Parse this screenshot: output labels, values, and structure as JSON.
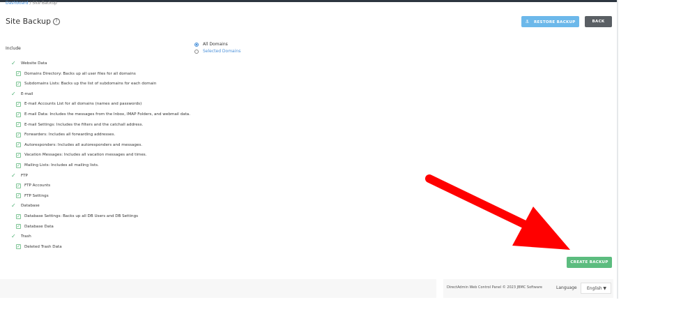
{
  "breadcrumb": {
    "parent": "Dashboard",
    "separator": " / ",
    "current": "Site Backup"
  },
  "page_title": "Site Backup",
  "help_icon": "question-circle-icon",
  "buttons": {
    "restore": "RESTORE BACKUP",
    "back": "BACK",
    "create": "CREATE BACKUP"
  },
  "include": {
    "label": "Include",
    "options": [
      "All Domains",
      "Selected Domains"
    ],
    "selected": "All Domains"
  },
  "tree": [
    {
      "type": "group",
      "label": "Website Data"
    },
    {
      "type": "item",
      "label": "Domains Directory: Backs up all user files for all domains"
    },
    {
      "type": "item",
      "label": "Subdomains Lists: Backs up the list of subdomains for each domain"
    },
    {
      "type": "group",
      "label": "E-mail"
    },
    {
      "type": "item",
      "label": "E-mail Accounts List for all domains (names and passwords)"
    },
    {
      "type": "item",
      "label": "E-mail Data: Includes the messages from the Inbox, IMAP Folders, and webmail data."
    },
    {
      "type": "item",
      "label": "E-mail Settings: Includes the filters and the catchall address."
    },
    {
      "type": "item",
      "label": "Forwarders: Includes all forwarding addresses."
    },
    {
      "type": "item",
      "label": "Autoresponders: Includes all autoresponders and messages."
    },
    {
      "type": "item",
      "label": "Vacation Messages: Includes all vacation messages and times."
    },
    {
      "type": "item",
      "label": "Mailing Lists: Includes all mailing lists."
    },
    {
      "type": "group",
      "label": "FTP"
    },
    {
      "type": "item",
      "label": "FTP Accounts"
    },
    {
      "type": "item",
      "label": "FTP Settings"
    },
    {
      "type": "group",
      "label": "Database"
    },
    {
      "type": "item",
      "label": "Database Settings: Backs up all DB Users and DB Settings"
    },
    {
      "type": "item",
      "label": "Database Data"
    },
    {
      "type": "group",
      "label": "Trash"
    },
    {
      "type": "item",
      "label": "Deleted Trash Data"
    }
  ],
  "footer": {
    "copyright": "DirectAdmin Web Control Panel © 2023 JBMC Software",
    "language_label": "Language",
    "language_value": "English"
  },
  "colors": {
    "accent_blue": "#6cb8ea",
    "back_gray": "#5a5f64",
    "create_green": "#5cbc7f",
    "check_green": "#4caf72",
    "arrow_red": "#ff0000"
  }
}
